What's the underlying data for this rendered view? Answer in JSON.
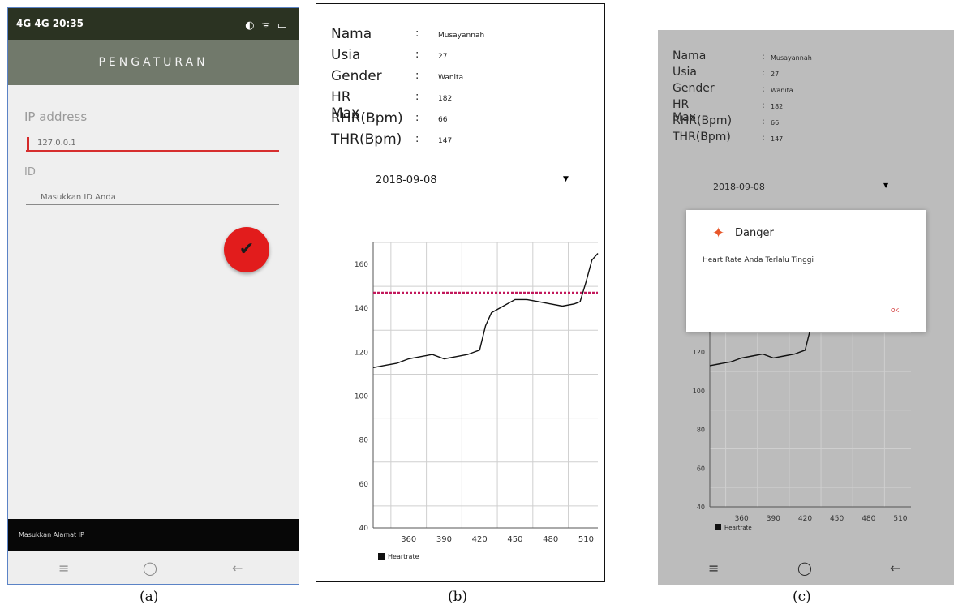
{
  "captions": [
    "(a)",
    "(b)",
    "(c)"
  ],
  "panel_a": {
    "status_bar": {
      "left": "4G 4G 20:35",
      "right": "◐ ᯤ ▭"
    },
    "app_bar_title": "PENGATURAN",
    "ip_label": "IP address",
    "ip_value": "127.0.0.1",
    "id_label": "ID",
    "id_placeholder": "Masukkan ID Anda",
    "confirm_icon": "check-icon",
    "snackbar_text": "Masukkan Alamat IP",
    "nav": {
      "menu": "≡",
      "home": "◯",
      "back": "←"
    }
  },
  "panel_b": {
    "profile": [
      {
        "label": "Nama",
        "value": "Musayannah"
      },
      {
        "label": "Usia",
        "value": "27"
      },
      {
        "label": "Gender",
        "value": "Wanita"
      },
      {
        "label": "HR Max",
        "value": "182"
      },
      {
        "label": "RHR(Bpm)",
        "value": "66"
      },
      {
        "label": "THR(Bpm)",
        "value": "147"
      }
    ],
    "colon": ":",
    "date": "2018-09-08",
    "dropdown_arrow": "▼",
    "legend": "Heartrate",
    "x_ticks": [
      "360",
      "390",
      "420",
      "450",
      "480",
      "510"
    ],
    "y_ticks": [
      "160",
      "140",
      "120",
      "100",
      "80",
      "60",
      "40"
    ],
    "threshold": 147
  },
  "panel_c": {
    "profile": [
      {
        "label": "Nama",
        "value": "Musayannah"
      },
      {
        "label": "Usia",
        "value": "27"
      },
      {
        "label": "Gender",
        "value": "Wanita"
      },
      {
        "label": "HR Max",
        "value": "182"
      },
      {
        "label": "RHR(Bpm)",
        "value": "66"
      },
      {
        "label": "THR(Bpm)",
        "value": "147"
      }
    ],
    "colon": ":",
    "date": "2018-09-08",
    "dropdown_arrow": "▼",
    "dialog": {
      "title": "Danger",
      "message": "Heart Rate Anda Terlalu Tinggi",
      "ok": "OK",
      "icon": "app-logo-icon"
    },
    "legend": "Heartrate",
    "x_ticks": [
      "360",
      "390",
      "420",
      "450",
      "480",
      "510"
    ],
    "y_ticks": [
      "120",
      "100",
      "80",
      "60",
      "40"
    ],
    "nav": {
      "menu": "≡",
      "home": "◯",
      "back": "←"
    }
  },
  "colors": {
    "accent_red": "#e21c1c",
    "app_bar": "#71796b",
    "threshold_line": "#c2185b"
  },
  "chart_data": {
    "type": "line",
    "series": [
      {
        "x": [
          330,
          340,
          350,
          360,
          370,
          380,
          390,
          400,
          410,
          415,
          420,
          425,
          430,
          440,
          450,
          460,
          470,
          480,
          490,
          500,
          505,
          510,
          515,
          520
        ],
        "values": [
          113,
          114,
          115,
          117,
          118,
          119,
          117,
          118,
          119,
          120,
          121,
          132,
          138,
          141,
          144,
          144,
          143,
          142,
          141,
          142,
          143,
          152,
          162,
          165
        ]
      }
    ],
    "threshold": 147,
    "xlim": [
      330,
      520
    ],
    "ylim": [
      40,
      170
    ],
    "x_ticks": [
      360,
      390,
      420,
      450,
      480,
      510
    ],
    "y_ticks": [
      40,
      60,
      80,
      100,
      120,
      140,
      160
    ],
    "legend": [
      "Heartrate"
    ]
  }
}
